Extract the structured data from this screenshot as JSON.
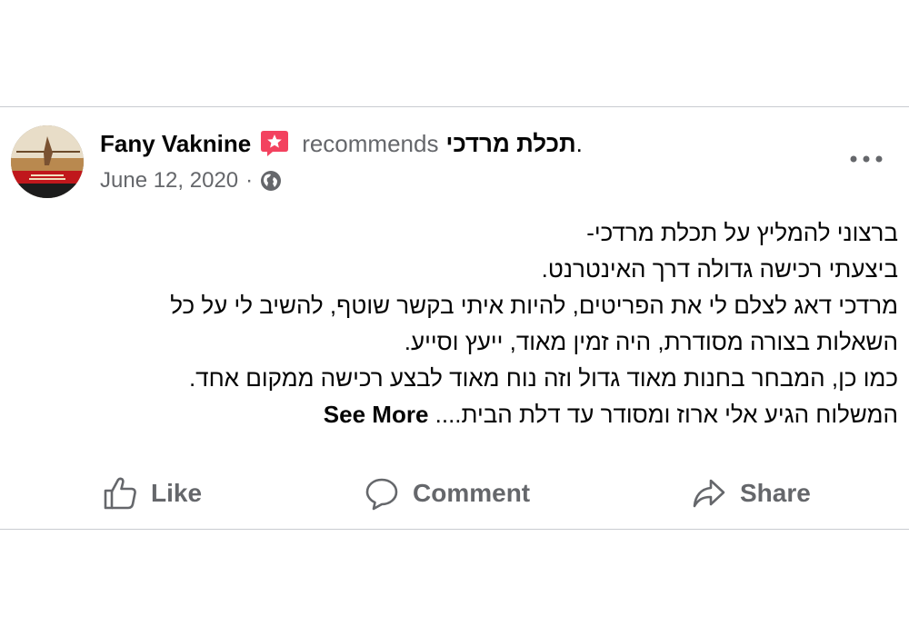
{
  "post": {
    "author": "Fany Vaknine",
    "recommends_text": "recommends",
    "page_name": "תכלת מרדכי",
    "period": ".",
    "date": "June 12, 2020",
    "meta_separator": "·",
    "icons": {
      "badge": "recommendation-star-icon",
      "privacy": "globe-icon",
      "more": "more-options-icon"
    },
    "body_lines": [
      "ברצוני להמליץ על תכלת מרדכי-",
      "ביצעתי רכישה גדולה דרך האינטרנט.",
      "מרדכי דאג לצלם לי את הפריטים, להיות איתי בקשר שוטף, להשיב לי על כל",
      "השאלות בצורה מסודרת, היה זמין מאוד, ייעץ וסייע.",
      "כמו כן, המבחר בחנות מאוד גדול וזה נוח מאוד לבצע רכישה ממקום אחד.",
      "המשלוח הגיע אלי ארוז ומסודר עד דלת הבית...."
    ],
    "see_more": "See More",
    "colors": {
      "badge": "#f3425f",
      "secondary_text": "#65676b",
      "divider": "#c9ccd1"
    }
  },
  "actions": {
    "like": "Like",
    "comment": "Comment",
    "share": "Share"
  }
}
